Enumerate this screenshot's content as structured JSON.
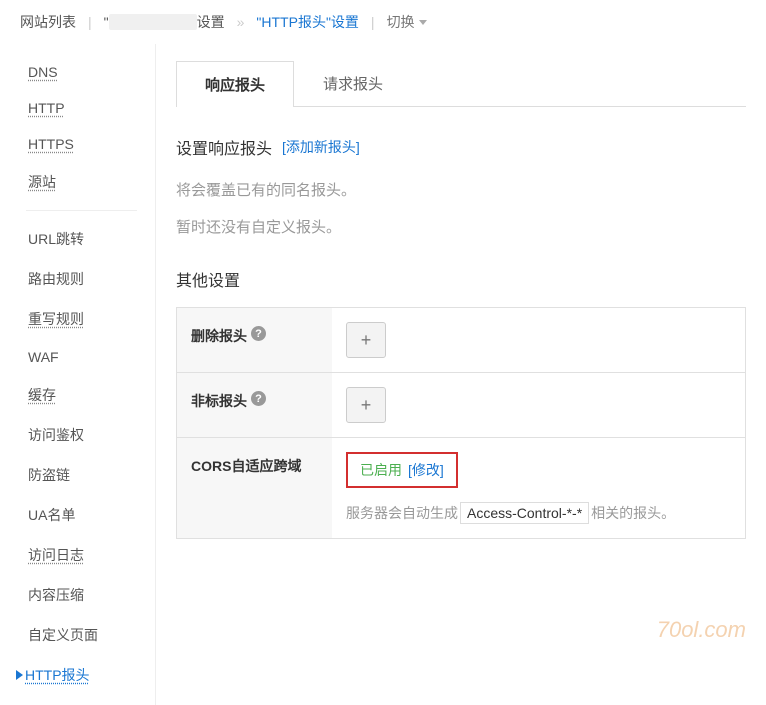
{
  "breadcrumb": {
    "root": "网站列表",
    "site_setting_suffix": "设置",
    "http_header": "\"HTTP报头\"设置",
    "switch": "切换"
  },
  "sidebar": {
    "items": [
      {
        "label": "DNS",
        "key": "dns",
        "dotted": true
      },
      {
        "label": "HTTP",
        "key": "http",
        "dotted": true
      },
      {
        "label": "HTTPS",
        "key": "https",
        "dotted": true
      },
      {
        "label": "源站",
        "key": "origin",
        "dotted": true
      },
      {
        "label": "URL跳转",
        "key": "url-redirect",
        "dotted": false
      },
      {
        "label": "路由规则",
        "key": "route-rules",
        "dotted": false
      },
      {
        "label": "重写规则",
        "key": "rewrite-rules",
        "dotted": true
      },
      {
        "label": "WAF",
        "key": "waf",
        "dotted": false
      },
      {
        "label": "缓存",
        "key": "cache",
        "dotted": true
      },
      {
        "label": "访问鉴权",
        "key": "auth",
        "dotted": false
      },
      {
        "label": "防盗链",
        "key": "anti-leech",
        "dotted": false
      },
      {
        "label": "UA名单",
        "key": "ua-list",
        "dotted": false
      },
      {
        "label": "访问日志",
        "key": "access-log",
        "dotted": true
      },
      {
        "label": "内容压缩",
        "key": "compression",
        "dotted": false
      },
      {
        "label": "自定义页面",
        "key": "custom-page",
        "dotted": false
      },
      {
        "label": "HTTP报头",
        "key": "http-header",
        "dotted": false,
        "active": true
      }
    ]
  },
  "tabs": {
    "response": "响应报头",
    "request": "请求报头"
  },
  "response_section": {
    "title": "设置响应报头",
    "add_link": "[添加新报头]",
    "desc1": "将会覆盖已有的同名报头。",
    "desc2": "暂时还没有自定义报头。"
  },
  "other_settings": {
    "title": "其他设置",
    "rows": {
      "delete_header": {
        "label": "删除报头"
      },
      "nonstd_header": {
        "label": "非标报头"
      },
      "cors": {
        "label": "CORS自适应跨域",
        "status": "已启用",
        "modify": "[修改]",
        "desc_prefix": "服务器会自动生成",
        "code": "Access-Control-*-*",
        "desc_suffix": "相关的报头。"
      }
    }
  },
  "watermark": "70ol.com"
}
